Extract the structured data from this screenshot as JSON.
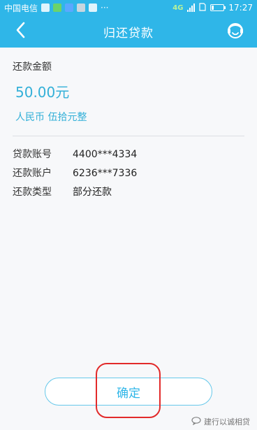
{
  "status_bar": {
    "carrier": "中国电信",
    "more_indicator": "···",
    "network": "4G",
    "time": "17:27"
  },
  "header": {
    "title": "归还贷款",
    "back_icon": "chevron-left-icon",
    "service_icon": "customer-service-icon"
  },
  "amount": {
    "label": "还款金额",
    "value": "50.00元",
    "chinese_value": "人民币 伍拾元整"
  },
  "details": [
    {
      "label": "贷款账号",
      "value": "4400***4334"
    },
    {
      "label": "还款账户",
      "value": "6236***7336"
    },
    {
      "label": "还款类型",
      "value": "部分还款"
    }
  ],
  "confirm_label": "确定",
  "watermark_text": "建行以诚相贷",
  "colors": {
    "primary": "#2fb6e8",
    "accent_text": "#33b0d8",
    "annotation": "#e22a2a"
  }
}
